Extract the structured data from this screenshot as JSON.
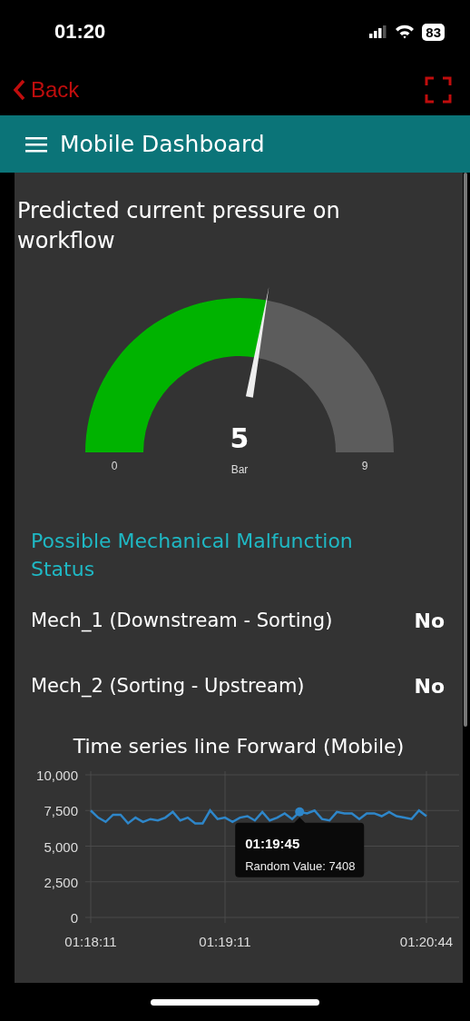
{
  "status_bar": {
    "time": "01:20",
    "battery": "83"
  },
  "nav": {
    "back": "Back"
  },
  "header": {
    "title": "Mobile Dashboard"
  },
  "gauge": {
    "title": "Predicted current pressure on workflow",
    "value": "5",
    "unit": "Bar",
    "min": "0",
    "max": "9"
  },
  "malfunction": {
    "heading": "Possible Mechanical Malfunction Status",
    "rows": [
      {
        "label": "Mech_1 (Downstream - Sorting)",
        "value": "No"
      },
      {
        "label": "Mech_2 (Sorting - Upstream)",
        "value": "No"
      }
    ]
  },
  "chart": {
    "tooltip": {
      "time": "01:19:45",
      "label": "Random Value: 7408"
    },
    "chart_data": {
      "type": "line",
      "title": "Time series line Forward (Mobile)",
      "grid": true,
      "categories": [
        "01:18:11",
        null,
        null,
        null,
        null,
        null,
        null,
        null,
        null,
        null,
        null,
        null,
        null,
        null,
        null,
        null,
        null,
        null,
        "01:19:11",
        null,
        null,
        null,
        null,
        null,
        null,
        null,
        null,
        null,
        null,
        null,
        null,
        null,
        null,
        null,
        null,
        null,
        null,
        null,
        null,
        null,
        null,
        null,
        null,
        null,
        null,
        "01:20:44"
      ],
      "series": [
        {
          "color": "#2e86c9",
          "values": [
            7500,
            7000,
            6700,
            7200,
            7200,
            6600,
            7000,
            6700,
            6900,
            6800,
            7000,
            7400,
            6800,
            7000,
            6600,
            6600,
            7500,
            6900,
            7000,
            6700,
            7000,
            7100,
            6800,
            7400,
            6800,
            7000,
            7300,
            6900,
            7400,
            7300,
            7500,
            6900,
            6800,
            7400,
            7300,
            7300,
            6900,
            7300,
            7300,
            7100,
            7400,
            7100,
            7000,
            6900,
            7500,
            7100
          ]
        }
      ],
      "ylim": [
        0,
        10000
      ],
      "yticks": [
        {
          "value": 0,
          "label": "0"
        },
        {
          "value": 2500,
          "label": "2,500"
        },
        {
          "value": 5000,
          "label": "5,000"
        },
        {
          "value": 7500,
          "label": "7,500"
        },
        {
          "value": 10000,
          "label": "10,000"
        }
      ]
    }
  }
}
